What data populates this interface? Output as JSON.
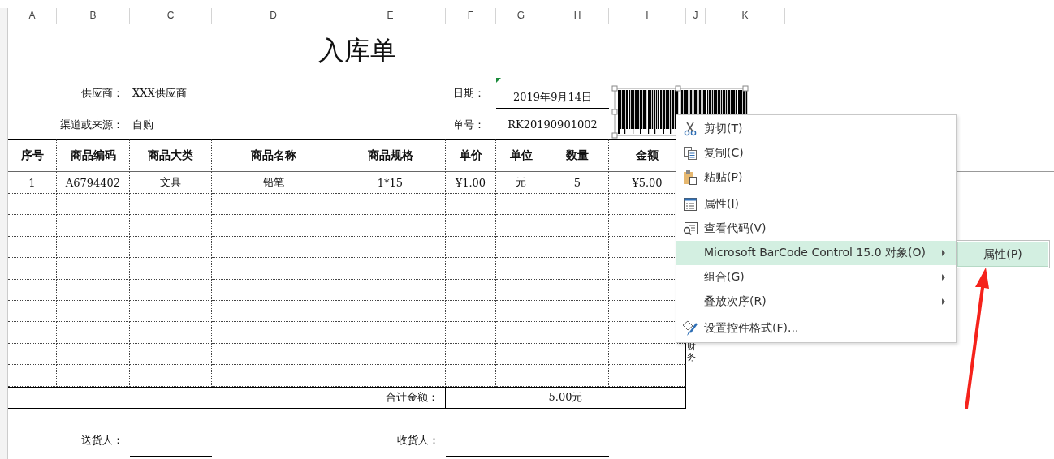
{
  "column_headers": [
    "A",
    "B",
    "C",
    "D",
    "E",
    "F",
    "G",
    "H",
    "I",
    "J",
    "K"
  ],
  "title": "入库单",
  "header_info": {
    "supplier_label": "供应商：",
    "supplier_value": "XXX供应商",
    "channel_label": "渠道或来源：",
    "channel_value": "自购",
    "date_label": "日期：",
    "date_value": "2019年9月14日",
    "number_label": "单号：",
    "number_value": "RK20190901002"
  },
  "table": {
    "columns": [
      "序号",
      "商品编码",
      "商品大类",
      "商品名称",
      "商品规格",
      "单价",
      "单位",
      "数量",
      "金额"
    ],
    "rows": [
      [
        "1",
        "A6794402",
        "文具",
        "铅笔",
        "1*15",
        "¥1.00",
        "元",
        "5",
        "¥5.00"
      ]
    ]
  },
  "total": {
    "label": "合计金额：",
    "value": "5.00元"
  },
  "signatures": [
    {
      "label": "送货人："
    },
    {
      "label": "收货人："
    }
  ],
  "side_note": "财务",
  "context_menu": {
    "items": [
      {
        "kind": "item",
        "label": "剪切(T)",
        "submenu": false,
        "selected": false
      },
      {
        "kind": "item",
        "label": "复制(C)",
        "submenu": false,
        "selected": false
      },
      {
        "kind": "item",
        "label": "粘贴(P)",
        "submenu": false,
        "selected": false
      },
      {
        "kind": "separator"
      },
      {
        "kind": "item",
        "label": "属性(I)",
        "submenu": false,
        "selected": false
      },
      {
        "kind": "item",
        "label": "查看代码(V)",
        "submenu": false,
        "selected": false
      },
      {
        "kind": "item",
        "label": "Microsoft BarCode Control 15.0 对象(O)",
        "submenu": true,
        "selected": true
      },
      {
        "kind": "item",
        "label": "组合(G)",
        "submenu": true,
        "selected": false
      },
      {
        "kind": "item",
        "label": "叠放次序(R)",
        "submenu": true,
        "selected": false
      },
      {
        "kind": "separator"
      },
      {
        "kind": "item",
        "label": "设置控件格式(F)...",
        "submenu": false,
        "selected": false
      }
    ]
  },
  "submenu": {
    "items": [
      {
        "label": "属性(P)",
        "selected": true
      }
    ]
  }
}
